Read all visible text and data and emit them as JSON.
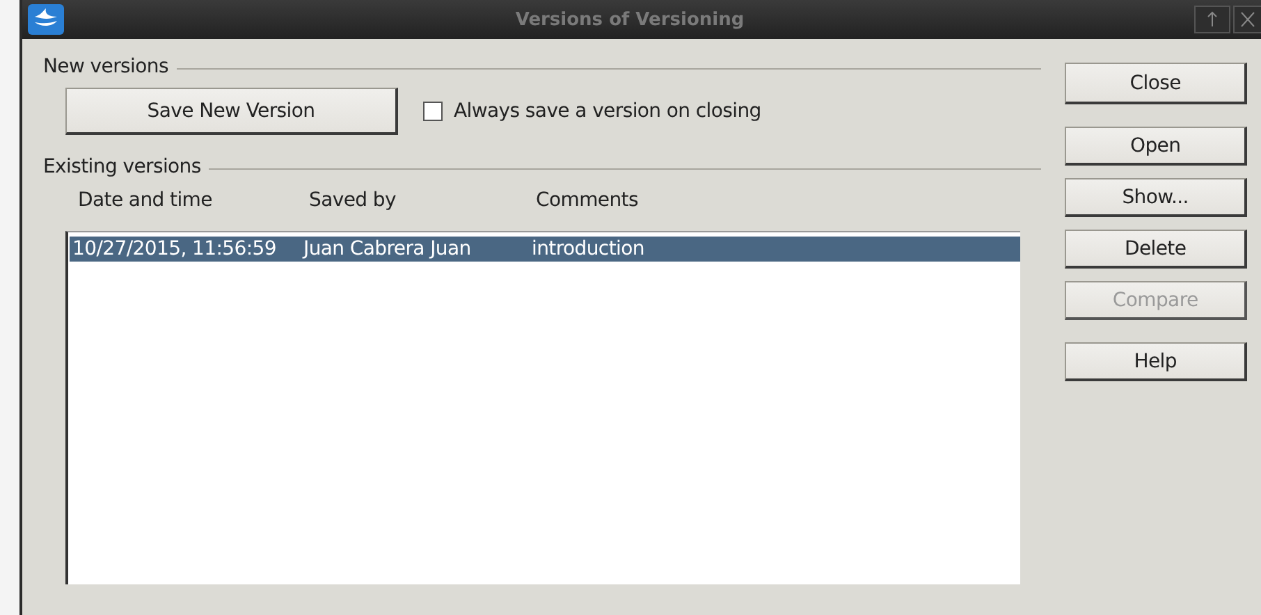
{
  "window": {
    "title": "Versions of Versioning"
  },
  "new_versions": {
    "heading": "New versions",
    "save_button": {
      "label": "Save New Version"
    },
    "always_save": {
      "label": "Always save a version on closing",
      "checked": false
    }
  },
  "existing_versions": {
    "heading": "Existing versions",
    "columns": [
      {
        "label": "Date and time"
      },
      {
        "label": "Saved by"
      },
      {
        "label": "Comments"
      }
    ],
    "rows": [
      {
        "cells": [
          "10/27/2015, 11:56:59",
          "Juan Cabrera Juan",
          "introduction"
        ],
        "selected": true
      }
    ]
  },
  "buttons": [
    {
      "label": "Close",
      "disabled": false
    },
    {
      "label": "Open",
      "disabled": false
    },
    {
      "label": "Show...",
      "disabled": false
    },
    {
      "label": "Delete",
      "disabled": false
    },
    {
      "label": "Compare",
      "disabled": true
    },
    {
      "label": "Help",
      "disabled": false
    }
  ]
}
